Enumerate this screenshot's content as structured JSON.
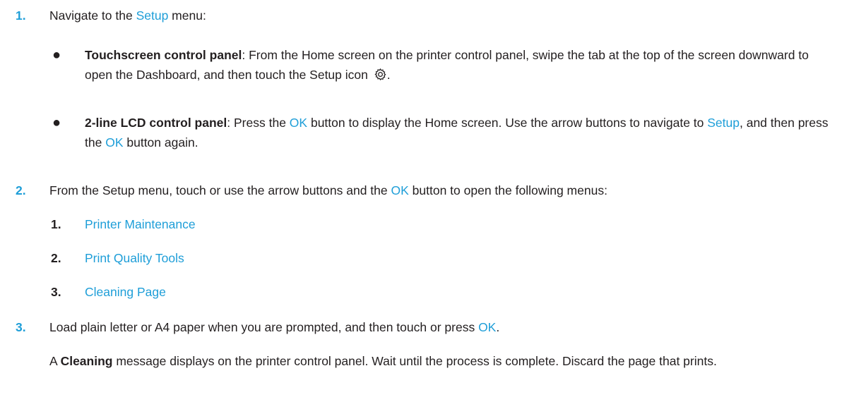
{
  "steps": [
    {
      "number": "1.",
      "before": "Navigate to the ",
      "link": "Setup",
      "after": " menu:"
    },
    {
      "number": "2.",
      "before": "From the Setup menu, touch or use the arrow buttons and the ",
      "link": "OK",
      "after": " button to open the following menus:"
    },
    {
      "number": "3.",
      "before": "Load plain letter or A4 paper when you are prompted, and then touch or press ",
      "link": "OK",
      "after": ".",
      "note": {
        "before": "A ",
        "bold": "Cleaning",
        "after": " message displays on the printer control panel. Wait until the process is complete. Discard the page that prints."
      }
    }
  ],
  "bullets": [
    {
      "title": "Touchscreen control panel",
      "text": ": From the Home screen on the printer control panel, swipe the tab at the top of the screen downward to open the Dashboard, and then touch the Setup icon ",
      "icon": "gear-icon",
      "end": "."
    },
    {
      "title": "2-line LCD control panel",
      "text1": ": Press the ",
      "ok1": "OK",
      "text2": " button to display the Home screen. Use the arrow buttons to navigate to ",
      "setup": "Setup",
      "text3": ", and then press the ",
      "ok2": "OK",
      "text4": " button again."
    }
  ],
  "submenus": [
    {
      "number": "1.",
      "label": "Printer Maintenance"
    },
    {
      "number": "2.",
      "label": "Print Quality Tools"
    },
    {
      "number": "3.",
      "label": "Cleaning Page"
    }
  ],
  "colors": {
    "link": "#1e9ed8",
    "text": "#231f20"
  }
}
